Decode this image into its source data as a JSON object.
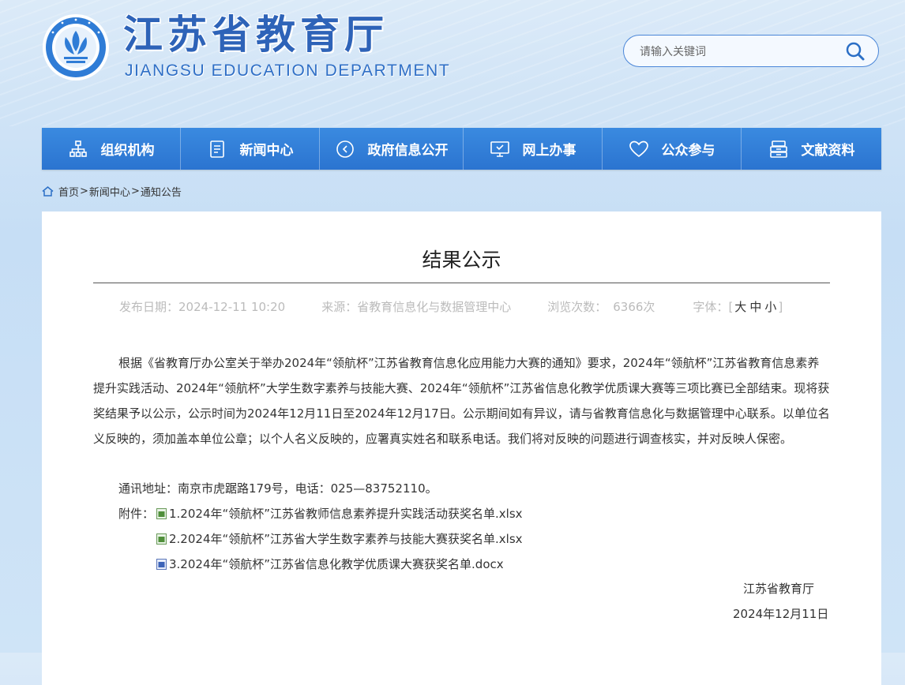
{
  "header": {
    "title": "江苏省教育厅",
    "subtitle": "JIANGSU EDUCATION DEPARTMENT",
    "logo_icon": "emblem-icon"
  },
  "search": {
    "placeholder": "请输入关键词",
    "icon": "search-icon"
  },
  "nav": {
    "items": [
      {
        "label": "组织机构",
        "icon": "org-chart-icon"
      },
      {
        "label": "新闻中心",
        "icon": "document-icon"
      },
      {
        "label": "政府信息公开",
        "icon": "arrow-circle-icon"
      },
      {
        "label": "网上办事",
        "icon": "monitor-icon"
      },
      {
        "label": "公众参与",
        "icon": "heart-icon"
      },
      {
        "label": "文献资料",
        "icon": "archive-icon"
      }
    ]
  },
  "breadcrumb": {
    "home": "首页",
    "sep": ">",
    "level1": "新闻中心",
    "level2": "通知公告"
  },
  "article": {
    "title": "结果公示",
    "meta": {
      "date_label": "发布日期：",
      "date": "2024-12-11 10:20",
      "source_label": "来源：",
      "source": "省教育信息化与数据管理中心",
      "views_label": "浏览次数：",
      "views": "6366次",
      "font_label": "字体：",
      "font_large": "大",
      "font_medium": "中",
      "font_small": "小"
    },
    "paragraph": "根据《省教育厅办公室关于举办2024年“领航杯”江苏省教育信息化应用能力大赛的通知》要求，2024年“领航杯”江苏省教育信息素养提升实践活动、2024年“领航杯”大学生数字素养与技能大赛、2024年“领航杯”江苏省信息化教学优质课大赛等三项比赛已全部结束。现将获奖结果予以公示，公示时间为2024年12月11日至2024年12月17日。公示期间如有异议，请与省教育信息化与数据管理中心联系。以单位名义反映的，须加盖本单位公章；以个人名义反映的，应署真实姓名和联系电话。我们将对反映的问题进行调查核实，并对反映人保密。",
    "address": "通讯地址：南京市虎踞路179号，电话：025—83752110。",
    "attachments_label": "附件：",
    "attachments": [
      {
        "name": "1.2024年“领航杯”江苏省教师信息素养提升实践活动获奖名单.xlsx",
        "icon": "excel-file-icon"
      },
      {
        "name": "2.2024年“领航杯”江苏省大学生数字素养与技能大赛获奖名单.xlsx",
        "icon": "excel-file-icon"
      },
      {
        "name": "3.2024年“领航杯”江苏省信息化教学优质课大赛获奖名单.docx",
        "icon": "word-file-icon"
      }
    ],
    "signature": "江苏省教育厅",
    "sign_date": "2024年12月11日"
  },
  "colors": {
    "nav_bg": "#2f7cd6",
    "title_blue": "#2e63b8",
    "meta_gray": "#bbbbbb"
  }
}
